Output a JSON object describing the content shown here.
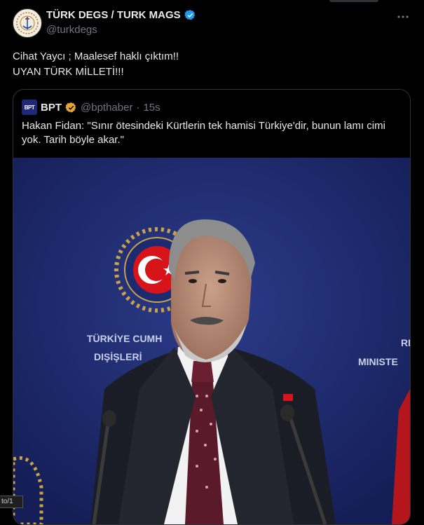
{
  "author": {
    "name": "TÜRK DEGS / TURK MAGS",
    "handle": "@turkdegs",
    "verified_color": "#1d9bf0",
    "avatar_icon": "round-emblem-icon"
  },
  "tweet": {
    "line1": "Cihat Yaycı ; Maalesef haklı çıktım!!",
    "line2": "UYAN TÜRK MİLLETİ!!!"
  },
  "more_icon": "more-options-icon",
  "quote": {
    "avatar_text": "BPT",
    "name": "BPT",
    "handle": "@bpthaber",
    "separator": "·",
    "time": "15s",
    "verified_color": "#e8a33a",
    "text": "Hakan Fidan: \"Sınır ötesindeki Kürtlerin tek hamisi Türkiye'dir, bunun lamı cimi yok. Tarih böyle akar.\"",
    "image": {
      "backdrop_text_left_1": "TÜRKİYE CUMH",
      "backdrop_text_left_2": "DIŞİŞLERİ",
      "backdrop_text_right_1": "RE",
      "backdrop_text_right_2": "MINISTE"
    }
  },
  "status_chip": "to/1"
}
